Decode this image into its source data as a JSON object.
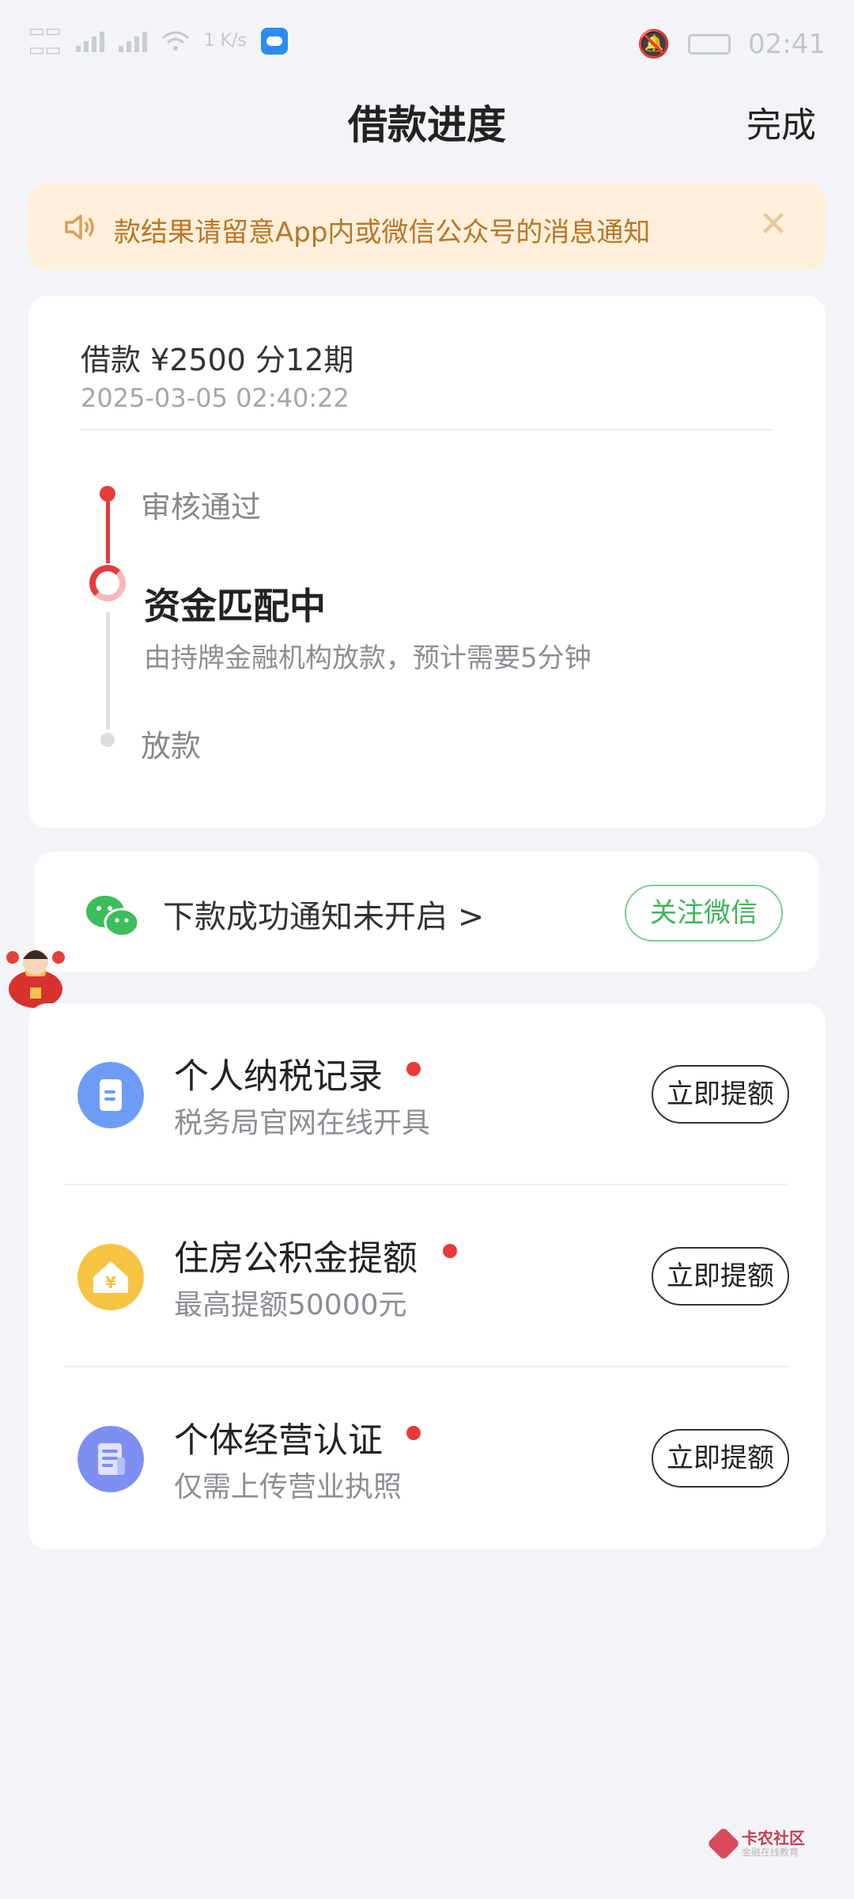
{
  "status_bar": {
    "network_speed": "1 K/s",
    "time": "02:41"
  },
  "header": {
    "title": "借款进度",
    "done_label": "完成"
  },
  "notice": {
    "text": "款结果请留意App内或微信公众号的消息通知"
  },
  "loan": {
    "summary": "借款 ¥2500   分12期",
    "timestamp": "2025-03-05 02:40:22"
  },
  "timeline": [
    {
      "label": "审核通过",
      "state": "done"
    },
    {
      "label": "资金匹配中",
      "desc": "由持牌金融机构放款，预计需要5分钟",
      "state": "active"
    },
    {
      "label": "放款",
      "state": "pending"
    }
  ],
  "wechat": {
    "text": "下款成功通知未开启 >",
    "follow_label": "关注微信"
  },
  "tasks": [
    {
      "title": "个人纳税记录",
      "subtitle": "税务局官网在线开具",
      "button": "立即提额",
      "icon": "document-icon",
      "color": "#6c9cf6"
    },
    {
      "title": "住房公积金提额",
      "subtitle": "最高提额50000元",
      "button": "立即提额",
      "icon": "house-yuan-icon",
      "color": "#f6c343"
    },
    {
      "title": "个体经营认证",
      "subtitle": "仅需上传营业执照",
      "button": "立即提额",
      "icon": "license-icon",
      "color": "#7f8ef3"
    }
  ],
  "watermark": {
    "main": "卡农社区",
    "sub": "金融在线教育"
  },
  "colors": {
    "accent_red": "#e23d3d",
    "notice_bg": "#fdefd9",
    "notice_text": "#b8762b",
    "wechat_green": "#3fb45b"
  }
}
